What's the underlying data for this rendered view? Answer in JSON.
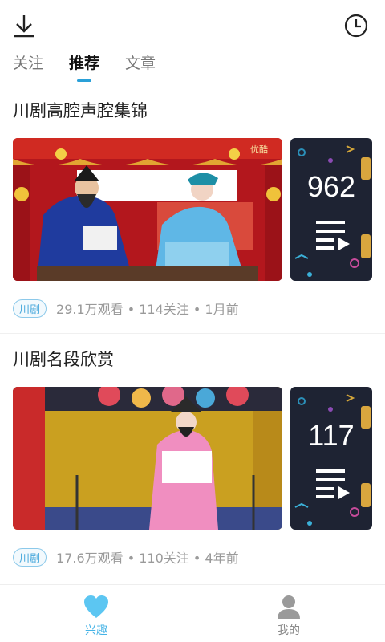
{
  "tabs": [
    {
      "label": "关注",
      "active": false
    },
    {
      "label": "推荐",
      "active": true
    },
    {
      "label": "文章",
      "active": false
    }
  ],
  "icons": {
    "download": "download-icon",
    "history": "clock-icon",
    "playlist": "playlist-icon",
    "interest": "heart-icon",
    "mine": "user-icon"
  },
  "colors": {
    "accent": "#2aa0d8",
    "tag_border": "#8cc9ea",
    "side_panel": "#1e2333"
  },
  "feed": [
    {
      "title": "川剧高腔声腔集锦",
      "thumbnail_watermark": "优酷",
      "video_count": "962",
      "tag": "川剧",
      "meta": "29.1万观看 • 114关注 • 1月前"
    },
    {
      "title": "川剧名段欣赏",
      "thumbnail_watermark": "",
      "video_count": "117",
      "tag": "川剧",
      "meta": "17.6万观看 • 110关注 • 4年前"
    }
  ],
  "bottom_nav": [
    {
      "label": "兴趣",
      "active": true
    },
    {
      "label": "我的",
      "active": false
    }
  ]
}
